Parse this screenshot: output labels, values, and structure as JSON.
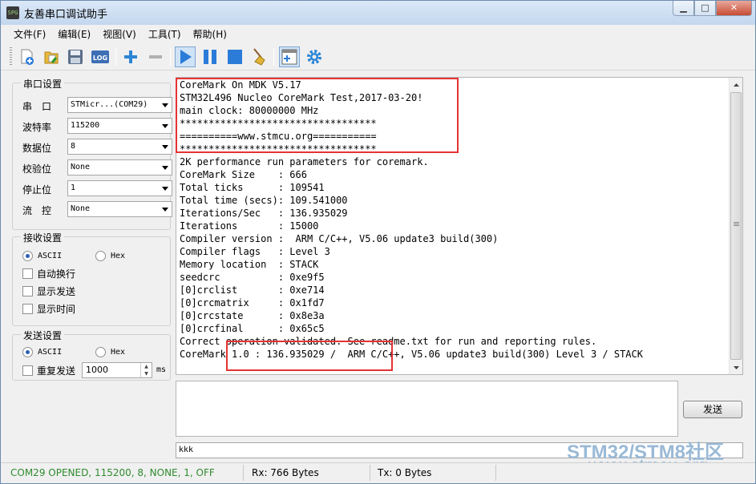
{
  "window": {
    "title": "友善串口调试助手",
    "app_icon_text": "SPG",
    "buttons": {
      "minimize": "▁",
      "maximize": "□",
      "close": "✕"
    }
  },
  "menu": [
    "文件(F)",
    "编辑(E)",
    "视图(V)",
    "工具(T)",
    "帮助(H)"
  ],
  "toolbar": {
    "items": [
      "new-icon",
      "open-icon",
      "save-icon",
      "log-icon",
      "add-icon",
      "remove-icon",
      "play-icon",
      "pause-icon",
      "stop-icon",
      "clear-icon",
      "add-window-icon",
      "settings-icon"
    ],
    "log_label": "LOG"
  },
  "serial_settings": {
    "title": "串口设置",
    "port": {
      "label": "串　口",
      "value": "STMicr...(COM29)"
    },
    "baud": {
      "label": "波特率",
      "value": "115200"
    },
    "databits": {
      "label": "数据位",
      "value": "8"
    },
    "parity": {
      "label": "校验位",
      "value": "None"
    },
    "stopbits": {
      "label": "停止位",
      "value": "1"
    },
    "flow": {
      "label": "流　控",
      "value": "None"
    }
  },
  "receive_settings": {
    "title": "接收设置",
    "ascii": "ASCII",
    "hex": "Hex",
    "options": [
      "自动换行",
      "显示发送",
      "显示时间"
    ]
  },
  "send_settings": {
    "title": "发送设置",
    "ascii": "ASCII",
    "hex": "Hex",
    "repeat_label": "重复发送",
    "interval": "1000",
    "unit": "ms"
  },
  "receive_lines": [
    "CoreMark On MDK V5.17",
    "STM32L496 Nucleo CoreMark Test,2017-03-20!",
    "main clock: 80000000 MHz",
    "**********************************",
    "==========www.stmcu.org===========",
    "**********************************",
    "2K performance run parameters for coremark.",
    "CoreMark Size    : 666",
    "Total ticks      : 109541",
    "Total time (secs): 109.541000",
    "Iterations/Sec   : 136.935029",
    "Iterations       : 15000",
    "Compiler version :  ARM C/C++, V5.06 update3 build(300)",
    "Compiler flags   : Level 3",
    "Memory location  : STACK",
    "seedcrc          : 0xe9f5",
    "[0]crclist       : 0xe714",
    "[0]crcmatrix     : 0x1fd7",
    "[0]crcstate      : 0x8e3a",
    "[0]crcfinal      : 0x65c5",
    "Correct operation validated. See readme.txt for run and reporting rules.",
    "CoreMark 1.0 : 136.935029 /  ARM C/C++, V5.06 update3 build(300) Level 3 / STACK"
  ],
  "send": {
    "button": "发送",
    "history_value": "kkk"
  },
  "status": {
    "port_info": "COM29 OPENED, 115200, 8, NONE, 1, OFF",
    "rx": "Rx: 766 Bytes",
    "tx": "Tx: 0 Bytes",
    "port_color": "#2e8b2e"
  },
  "watermark": {
    "line1": "STM32/STM8社区",
    "line2": "www.stmcu.org"
  }
}
